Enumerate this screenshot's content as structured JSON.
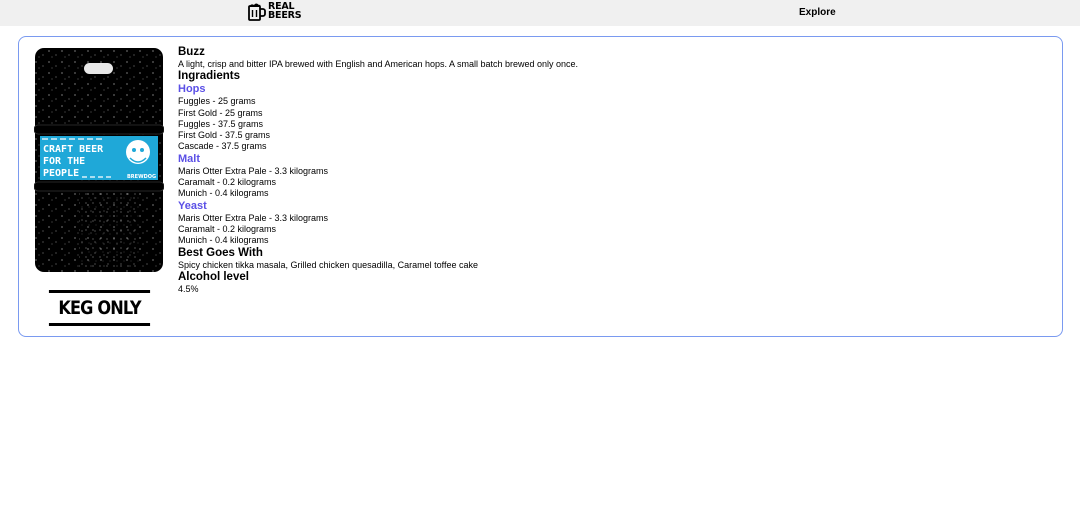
{
  "header": {
    "logo_line1": "REAL",
    "logo_line2": "BEERS",
    "nav_explore": "Explore"
  },
  "beer": {
    "name": "Buzz",
    "description": "A light, crisp and bitter IPA brewed with English and American hops. A small batch brewed only once.",
    "image": {
      "label_line1": "CRAFT BEER",
      "label_line2": "FOR THE",
      "label_line3": "PEOPLE",
      "brand": "BREWDOG",
      "keg_text": "KEG ONLY"
    },
    "ingredients_heading": "Ingradients",
    "hops_heading": "Hops",
    "hops": [
      "Fuggles - 25 grams",
      "First Gold - 25 grams",
      "Fuggles - 37.5 grams",
      "First Gold - 37.5 grams",
      "Cascade - 37.5 grams"
    ],
    "malt_heading": "Malt",
    "malt": [
      "Maris Otter Extra Pale - 3.3 kilograms",
      "Caramalt - 0.2 kilograms",
      "Munich - 0.4 kilograms"
    ],
    "yeast_heading": "Yeast",
    "yeast": [
      "Maris Otter Extra Pale - 3.3 kilograms",
      "Caramalt - 0.2 kilograms",
      "Munich - 0.4 kilograms"
    ],
    "food_heading": "Best Goes With",
    "food_pairing": "Spicy chicken tikka masala, Grilled chicken quesadilla, Caramel toffee cake",
    "alcohol_heading": "Alcohol level",
    "alcohol": "4.5%"
  },
  "colors": {
    "accent": "#5b50e6",
    "card_border": "#7a9af0",
    "label_blue": "#1fa8d8"
  }
}
